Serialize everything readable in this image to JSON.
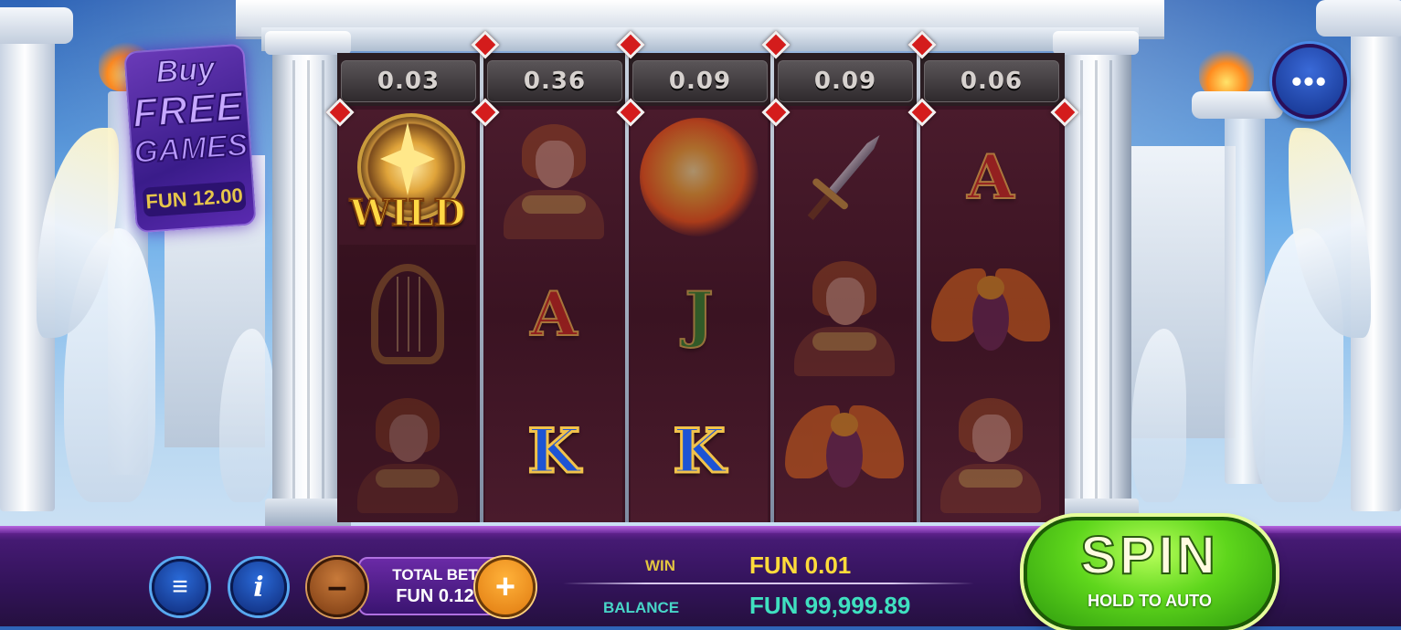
{
  "reels": {
    "multipliers": [
      "0.03",
      "0.36",
      "0.09",
      "0.09",
      "0.06"
    ],
    "columns": [
      [
        {
          "type": "wild",
          "label": "WILD",
          "icon": "wild-medallion-icon"
        },
        {
          "type": "harp",
          "icon": "golden-lyre-icon"
        },
        {
          "type": "hero",
          "icon": "hero-portrait-icon"
        }
      ],
      [
        {
          "type": "hero",
          "icon": "hero-portrait-icon"
        },
        {
          "type": "letter",
          "text": "A",
          "color": "red"
        },
        {
          "type": "letter",
          "text": "K",
          "color": "blue"
        }
      ],
      [
        {
          "type": "sun",
          "icon": "fire-sun-icon"
        },
        {
          "type": "letter",
          "text": "J",
          "color": "green"
        },
        {
          "type": "letter",
          "text": "K",
          "color": "blue"
        }
      ],
      [
        {
          "type": "dagger",
          "icon": "dagger-icon"
        },
        {
          "type": "hero",
          "icon": "hero-portrait-icon"
        },
        {
          "type": "phoenix",
          "icon": "phoenix-icon"
        }
      ],
      [
        {
          "type": "letter",
          "text": "A",
          "color": "red"
        },
        {
          "type": "phoenix",
          "icon": "phoenix-icon"
        },
        {
          "type": "hero",
          "icon": "hero-portrait-icon"
        }
      ]
    ]
  },
  "buy_free_games": {
    "line1": "Buy",
    "line2": "FREE",
    "line3": "GAMES",
    "price": "FUN 12.00"
  },
  "top_menu": {
    "icon": "more-options-icon",
    "glyph": "•••"
  },
  "bottom_bar": {
    "menu_glyph": "≡",
    "info_glyph": "i",
    "minus_glyph": "–",
    "plus_glyph": "+",
    "total_bet_label": "TOTAL BET",
    "total_bet_value": "FUN 0.12",
    "win_label": "WIN",
    "win_value": "FUN 0.01",
    "balance_label": "BALANCE",
    "balance_value": "FUN 99,999.89",
    "spin_label": "SPIN",
    "spin_sublabel": "HOLD TO AUTO"
  },
  "colors": {
    "spin_green": "#5ed61c",
    "bar_purple": "#321359",
    "win_gold": "#ffdb3a",
    "balance_teal": "#3fe0c0"
  }
}
